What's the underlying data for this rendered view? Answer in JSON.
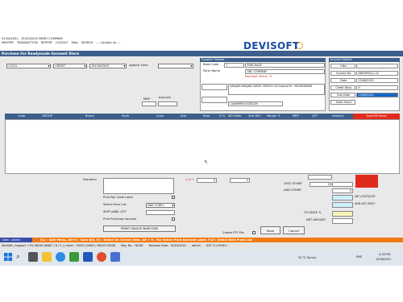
{
  "window": {
    "title": "01/04/2021 - 31/03/2022  DEMO COMPANY",
    "menu": [
      "MASTER",
      "TRANSACTION",
      "REPORT",
      "LOGOUT",
      "Help",
      "SEARCH",
      "--- Contact Us ---"
    ]
  },
  "brand": {
    "logo": "DEVISOFT"
  },
  "form": {
    "title": "Purchase For Readymade Garment Store"
  },
  "top_filters": {
    "location": "LOCAL",
    "payment": "CREDIT",
    "invoice_type": "TAX INVOICE",
    "against_form_label": "Against Form",
    "against_form_value": ""
  },
  "supplier": {
    "header": "Supplier Details",
    "book_code_label": "Book Code",
    "book_code_value": "7",
    "book_code_name": "PURCHASE",
    "party_name_label": "Party Name",
    "party_name_value": "ABC COMPANY",
    "payment_terms": "Payment Terms : 0",
    "address": "ADAJAN ADAJAN  SURAT 395005 24-Gujarat M : 9624046468",
    "gstin": "24AMMPS4332B1Z9"
  },
  "invoice": {
    "header": "Invoice Details",
    "vno_label": "V.No.",
    "vno_value": "",
    "invoice_no_label": "Invoice No",
    "invoice_no_value": "AB/5693/21-22",
    "date_label": "Date",
    "date_value": "15/08/2021",
    "credit_days_label": "Credit Days",
    "credit_days_value": "0",
    "due_date_label": "Due Date",
    "due_date_value": "15/08/2021",
    "sales_head_label": "Sales Head",
    "sales_head_value": ""
  },
  "mini": {
    "mrp_label": "MRP",
    "barcode_label": "BARCODE"
  },
  "grid": {
    "columns": [
      "Code",
      "GROUP",
      "Brand",
      "Style",
      "Color",
      "Size",
      "Rate",
      "D.%",
      "W.H.Rate",
      "Size Diff.",
      "Margin %",
      "MRP",
      "QTY",
      "Amount"
    ],
    "gold_detail": "Sold BR Detail"
  },
  "bottom": {
    "narration_label": "Narration",
    "narration_value": "",
    "print_barcode_label": "Print Bar Code Label",
    "select_from_list_label": "Select From List",
    "select_from_list_value": "BAR CODE1",
    "skip_label_qty_label": "SKIP LABEL QTY",
    "print_voucher_label": "Print Purchase Voucher",
    "print_single_barcode": "PRINT SINGLE BARCODE",
    "page_of": "1 of 1",
    "page_value_a": "0",
    "page_value_b": "0",
    "create_ptf_label": "Create PTF File",
    "save_label": "Save",
    "cancel_label": "Cancel"
  },
  "totals": {
    "less_other_label": "LESS OTHER",
    "less_other_value": "0",
    "add_other_label": "ADD OTHER",
    "add_other_value": "0",
    "vat_cgst_label": "VAT /CGST/IGST",
    "add_vat_label": "ADD.VAT /SGST",
    "tcs_label": "TCS RATE %",
    "net_amount_label": "NET AMOUNT",
    "gold_total": "",
    "total_value": ""
  },
  "status": {
    "user": "User : admin",
    "hint": "Esc : Quit Menu, Alt+S : Save Bill, F2 : Select On Screen Item, Alt + R : For Select Print Barcode Label, F10 : Select Item From List"
  },
  "footer": {
    "items": [
      "DevSoft | Support :+91-96240-46467 / 8 / 9 ] | Sales : 99251 45603 / 98243 03456",
      "Reg. No. : NODE",
      "Renewal Date : 31/03/2022",
      "admin",
      "GST 3.1.0908.1"
    ]
  },
  "taskbar": {
    "weather": "31°C  Sunny",
    "time": "4:33 PM",
    "date": "15/08/2021",
    "lang": "ENG"
  },
  "colors": {
    "title_bar": "#3c5f8c",
    "gold_detail": "#e02a1c",
    "hint_bar": "#f07a13",
    "status_bar": "#3a4ea8",
    "vat_fill": "#cdeefd",
    "tcs_fill": "#f7f3b6"
  }
}
